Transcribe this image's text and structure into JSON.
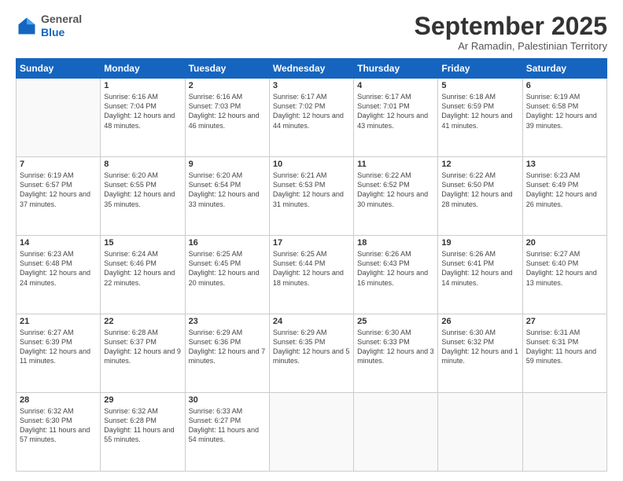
{
  "logo": {
    "general": "General",
    "blue": "Blue"
  },
  "header": {
    "month": "September 2025",
    "location": "Ar Ramadin, Palestinian Territory"
  },
  "weekdays": [
    "Sunday",
    "Monday",
    "Tuesday",
    "Wednesday",
    "Thursday",
    "Friday",
    "Saturday"
  ],
  "weeks": [
    [
      {
        "day": "",
        "sunrise": "",
        "sunset": "",
        "daylight": ""
      },
      {
        "day": "1",
        "sunrise": "Sunrise: 6:16 AM",
        "sunset": "Sunset: 7:04 PM",
        "daylight": "Daylight: 12 hours and 48 minutes."
      },
      {
        "day": "2",
        "sunrise": "Sunrise: 6:16 AM",
        "sunset": "Sunset: 7:03 PM",
        "daylight": "Daylight: 12 hours and 46 minutes."
      },
      {
        "day": "3",
        "sunrise": "Sunrise: 6:17 AM",
        "sunset": "Sunset: 7:02 PM",
        "daylight": "Daylight: 12 hours and 44 minutes."
      },
      {
        "day": "4",
        "sunrise": "Sunrise: 6:17 AM",
        "sunset": "Sunset: 7:01 PM",
        "daylight": "Daylight: 12 hours and 43 minutes."
      },
      {
        "day": "5",
        "sunrise": "Sunrise: 6:18 AM",
        "sunset": "Sunset: 6:59 PM",
        "daylight": "Daylight: 12 hours and 41 minutes."
      },
      {
        "day": "6",
        "sunrise": "Sunrise: 6:19 AM",
        "sunset": "Sunset: 6:58 PM",
        "daylight": "Daylight: 12 hours and 39 minutes."
      }
    ],
    [
      {
        "day": "7",
        "sunrise": "Sunrise: 6:19 AM",
        "sunset": "Sunset: 6:57 PM",
        "daylight": "Daylight: 12 hours and 37 minutes."
      },
      {
        "day": "8",
        "sunrise": "Sunrise: 6:20 AM",
        "sunset": "Sunset: 6:55 PM",
        "daylight": "Daylight: 12 hours and 35 minutes."
      },
      {
        "day": "9",
        "sunrise": "Sunrise: 6:20 AM",
        "sunset": "Sunset: 6:54 PM",
        "daylight": "Daylight: 12 hours and 33 minutes."
      },
      {
        "day": "10",
        "sunrise": "Sunrise: 6:21 AM",
        "sunset": "Sunset: 6:53 PM",
        "daylight": "Daylight: 12 hours and 31 minutes."
      },
      {
        "day": "11",
        "sunrise": "Sunrise: 6:22 AM",
        "sunset": "Sunset: 6:52 PM",
        "daylight": "Daylight: 12 hours and 30 minutes."
      },
      {
        "day": "12",
        "sunrise": "Sunrise: 6:22 AM",
        "sunset": "Sunset: 6:50 PM",
        "daylight": "Daylight: 12 hours and 28 minutes."
      },
      {
        "day": "13",
        "sunrise": "Sunrise: 6:23 AM",
        "sunset": "Sunset: 6:49 PM",
        "daylight": "Daylight: 12 hours and 26 minutes."
      }
    ],
    [
      {
        "day": "14",
        "sunrise": "Sunrise: 6:23 AM",
        "sunset": "Sunset: 6:48 PM",
        "daylight": "Daylight: 12 hours and 24 minutes."
      },
      {
        "day": "15",
        "sunrise": "Sunrise: 6:24 AM",
        "sunset": "Sunset: 6:46 PM",
        "daylight": "Daylight: 12 hours and 22 minutes."
      },
      {
        "day": "16",
        "sunrise": "Sunrise: 6:25 AM",
        "sunset": "Sunset: 6:45 PM",
        "daylight": "Daylight: 12 hours and 20 minutes."
      },
      {
        "day": "17",
        "sunrise": "Sunrise: 6:25 AM",
        "sunset": "Sunset: 6:44 PM",
        "daylight": "Daylight: 12 hours and 18 minutes."
      },
      {
        "day": "18",
        "sunrise": "Sunrise: 6:26 AM",
        "sunset": "Sunset: 6:43 PM",
        "daylight": "Daylight: 12 hours and 16 minutes."
      },
      {
        "day": "19",
        "sunrise": "Sunrise: 6:26 AM",
        "sunset": "Sunset: 6:41 PM",
        "daylight": "Daylight: 12 hours and 14 minutes."
      },
      {
        "day": "20",
        "sunrise": "Sunrise: 6:27 AM",
        "sunset": "Sunset: 6:40 PM",
        "daylight": "Daylight: 12 hours and 13 minutes."
      }
    ],
    [
      {
        "day": "21",
        "sunrise": "Sunrise: 6:27 AM",
        "sunset": "Sunset: 6:39 PM",
        "daylight": "Daylight: 12 hours and 11 minutes."
      },
      {
        "day": "22",
        "sunrise": "Sunrise: 6:28 AM",
        "sunset": "Sunset: 6:37 PM",
        "daylight": "Daylight: 12 hours and 9 minutes."
      },
      {
        "day": "23",
        "sunrise": "Sunrise: 6:29 AM",
        "sunset": "Sunset: 6:36 PM",
        "daylight": "Daylight: 12 hours and 7 minutes."
      },
      {
        "day": "24",
        "sunrise": "Sunrise: 6:29 AM",
        "sunset": "Sunset: 6:35 PM",
        "daylight": "Daylight: 12 hours and 5 minutes."
      },
      {
        "day": "25",
        "sunrise": "Sunrise: 6:30 AM",
        "sunset": "Sunset: 6:33 PM",
        "daylight": "Daylight: 12 hours and 3 minutes."
      },
      {
        "day": "26",
        "sunrise": "Sunrise: 6:30 AM",
        "sunset": "Sunset: 6:32 PM",
        "daylight": "Daylight: 12 hours and 1 minute."
      },
      {
        "day": "27",
        "sunrise": "Sunrise: 6:31 AM",
        "sunset": "Sunset: 6:31 PM",
        "daylight": "Daylight: 11 hours and 59 minutes."
      }
    ],
    [
      {
        "day": "28",
        "sunrise": "Sunrise: 6:32 AM",
        "sunset": "Sunset: 6:30 PM",
        "daylight": "Daylight: 11 hours and 57 minutes."
      },
      {
        "day": "29",
        "sunrise": "Sunrise: 6:32 AM",
        "sunset": "Sunset: 6:28 PM",
        "daylight": "Daylight: 11 hours and 55 minutes."
      },
      {
        "day": "30",
        "sunrise": "Sunrise: 6:33 AM",
        "sunset": "Sunset: 6:27 PM",
        "daylight": "Daylight: 11 hours and 54 minutes."
      },
      {
        "day": "",
        "sunrise": "",
        "sunset": "",
        "daylight": ""
      },
      {
        "day": "",
        "sunrise": "",
        "sunset": "",
        "daylight": ""
      },
      {
        "day": "",
        "sunrise": "",
        "sunset": "",
        "daylight": ""
      },
      {
        "day": "",
        "sunrise": "",
        "sunset": "",
        "daylight": ""
      }
    ]
  ]
}
